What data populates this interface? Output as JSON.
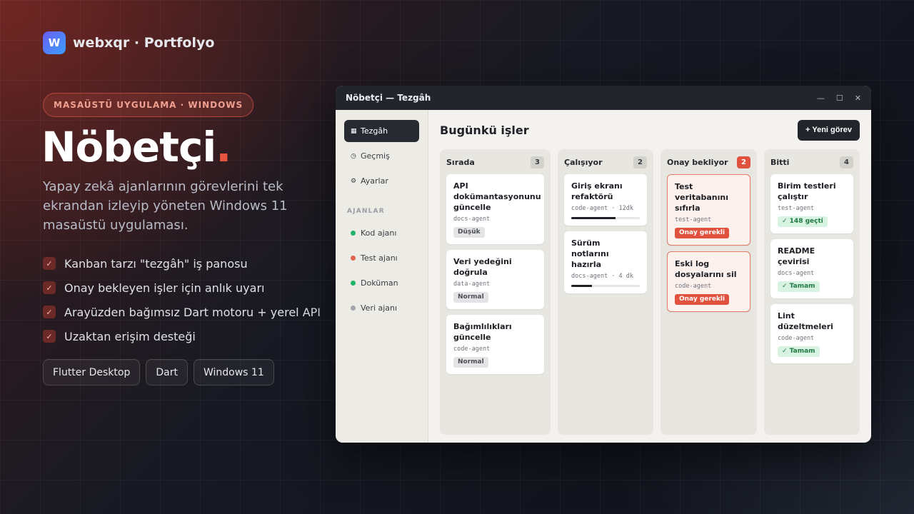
{
  "brand": {
    "logo_letter": "W",
    "name": "webxqr · Portfolyo"
  },
  "hero": {
    "badge": "MASAÜSTÜ UYGULAMA · WINDOWS",
    "title": "Nöbetçi",
    "title_dot": ".",
    "description": "Yapay zekâ ajanlarının görevlerini tek ekrandan izleyip yöneten Windows 11 masaüstü uygulaması.",
    "features": [
      "Kanban tarzı \"tezgâh\" iş panosu",
      "Onay bekleyen işler için anlık uyarı",
      "Arayüzden bağımsız Dart motoru + yerel API",
      "Uzaktan erişim desteği"
    ],
    "check_glyph": "✓",
    "tech_chips": [
      "Flutter Desktop",
      "Dart",
      "Windows 11"
    ]
  },
  "window": {
    "title": "Nöbetçi — Tezgâh",
    "controls": {
      "minimize": "—",
      "maximize": "☐",
      "close": "✕"
    },
    "sidebar": {
      "nav": [
        {
          "icon": "▦",
          "label": "Tezgâh",
          "active": true
        },
        {
          "icon": "◷",
          "label": "Geçmiş",
          "active": false
        },
        {
          "icon": "⚙",
          "label": "Ayarlar",
          "active": false
        }
      ],
      "agents_label": "AJANLAR",
      "agents": [
        {
          "label": "Kod ajanı",
          "color": "#22b36b"
        },
        {
          "label": "Test ajanı",
          "color": "#e0634e"
        },
        {
          "label": "Doküman",
          "color": "#22b36b"
        },
        {
          "label": "Veri ajanı",
          "color": "#a3a5ad"
        }
      ]
    },
    "main": {
      "title": "Bugünkü işler",
      "new_button": "+ Yeni görev",
      "columns": [
        {
          "title": "Sırada",
          "count": "3",
          "cards": [
            {
              "title": "API dokümantasyonunu güncelle",
              "agent": "docs-agent",
              "tag": "Düşük",
              "tag_style": "gray"
            },
            {
              "title": "Veri yedeğini doğrula",
              "agent": "data-agent",
              "tag": "Normal",
              "tag_style": "gray"
            },
            {
              "title": "Bağımlılıkları güncelle",
              "agent": "code-agent",
              "tag": "Normal",
              "tag_style": "gray"
            }
          ]
        },
        {
          "title": "Çalışıyor",
          "count": "2",
          "cards": [
            {
              "title": "Giriş ekranı refaktörü",
              "agent": "code-agent · 12dk",
              "progress": 0.65
            },
            {
              "title": "Sürüm notlarını hazırla",
              "agent": "docs-agent · 4 dk",
              "progress": 0.3
            }
          ]
        },
        {
          "title": "Onay bekliyor",
          "count": "2",
          "alert": true,
          "cards": [
            {
              "title": "Test veritabanını sıfırla",
              "agent": "test-agent",
              "tag": "Onay gerekli",
              "tag_style": "red",
              "pending": true
            },
            {
              "title": "Eski log dosyalarını sil",
              "agent": "code-agent",
              "tag": "Onay gerekli",
              "tag_style": "red",
              "pending": true
            }
          ]
        },
        {
          "title": "Bitti",
          "count": "4",
          "cards": [
            {
              "title": "Birim testleri çalıştır",
              "agent": "test-agent",
              "tag": "✓ 148 geçti",
              "tag_style": "green"
            },
            {
              "title": "README çevirisi",
              "agent": "docs-agent",
              "tag": "✓ Tamam",
              "tag_style": "green"
            },
            {
              "title": "Lint düzeltmeleri",
              "agent": "code-agent",
              "tag": "✓ Tamam",
              "tag_style": "green"
            }
          ]
        }
      ]
    }
  }
}
